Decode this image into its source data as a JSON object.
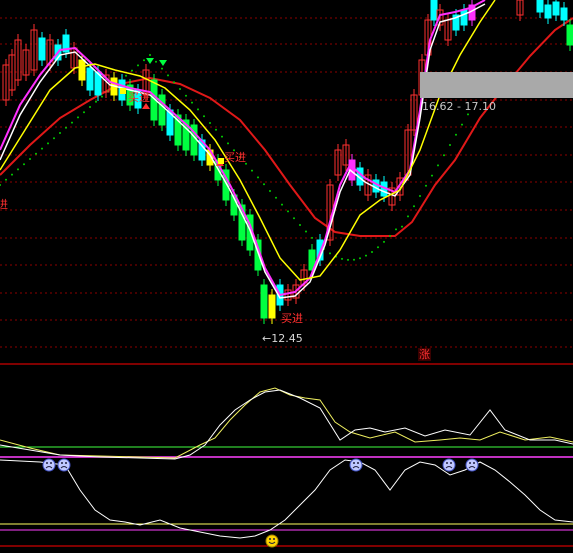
{
  "tooltip": {
    "price_range": "16.62 - 17.10"
  },
  "low_label": "←12.45",
  "buy_signal_label": "买进",
  "side_label": "进",
  "rise_badge": "涨",
  "colors": {
    "background": "#000000",
    "candle_up": "#ff3030",
    "candle_down": "#00ffff",
    "candle_green": "#00ff40",
    "ma_white": "#ffffff",
    "ma_yellow": "#ffff00",
    "ma_red": "#e01818",
    "ma_magenta": "#ff30ff",
    "signal_dots": "#00d000",
    "grid": "#8b0000",
    "separator": "#ff0000",
    "indicator_line_white": "#ffffff",
    "indicator_line_yellow": "#f0f060",
    "guide_green": "#40ff40",
    "guide_magenta": "#ff40ff",
    "guide_yellow": "#ffff60"
  },
  "icons": {
    "sell_marker": "sad-face-icon",
    "buy_marker": "happy-face-icon",
    "buy_arrow": "triangle-up-icon",
    "sell_arrow": "triangle-down-icon"
  }
}
